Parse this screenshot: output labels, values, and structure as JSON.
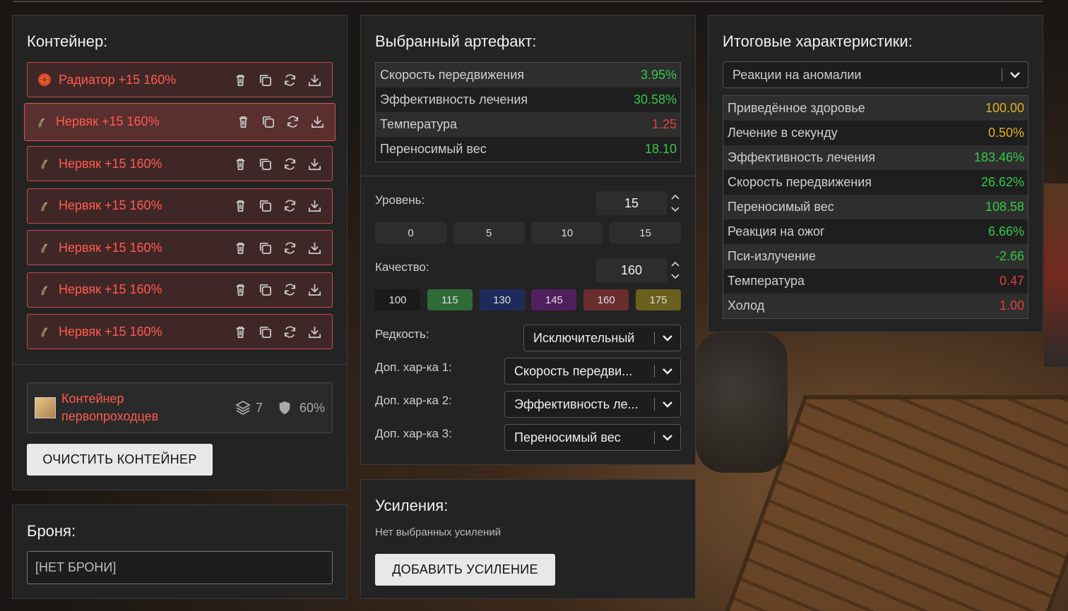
{
  "container": {
    "title": "Контейнер:",
    "artifacts": [
      {
        "name": "Радиатор +15 160%",
        "icon": "radiator-artifact-icon"
      },
      {
        "name": "Нервяк +15 160%",
        "icon": "nerviak-artifact-icon"
      },
      {
        "name": "Нервяк +15 160%",
        "icon": "nerviak-artifact-icon"
      },
      {
        "name": "Нервяк +15 160%",
        "icon": "nerviak-artifact-icon"
      },
      {
        "name": "Нервяк +15 160%",
        "icon": "nerviak-artifact-icon"
      },
      {
        "name": "Нервяк +15 160%",
        "icon": "nerviak-artifact-icon"
      },
      {
        "name": "Нервяк +15 160%",
        "icon": "nerviak-artifact-icon"
      }
    ],
    "selected_index": 1,
    "card": {
      "name_line1": "Контейнер",
      "name_line2": "первопроходцев",
      "slots": "7",
      "protection": "60%"
    },
    "clear_label": "ОЧИСТИТЬ КОНТЕЙНЕР"
  },
  "armor": {
    "title": "Броня:",
    "value": "[НЕТ БРОНИ]"
  },
  "artifact": {
    "title": "Выбранный артефакт:",
    "stats": [
      {
        "label": "Скорость передвижения",
        "value": "3.95%",
        "color": "green"
      },
      {
        "label": "Эффективность лечения",
        "value": "30.58%",
        "color": "green"
      },
      {
        "label": "Температура",
        "value": "1.25",
        "color": "red"
      },
      {
        "label": "Переносимый вес",
        "value": "18.10",
        "color": "green"
      }
    ],
    "level_label": "Уровень:",
    "level_value": "15",
    "level_presets": [
      "0",
      "5",
      "10",
      "15"
    ],
    "quality_label": "Качество:",
    "quality_value": "160",
    "quality_presets": [
      {
        "label": "100",
        "color": "#1a1a1a"
      },
      {
        "label": "115",
        "color": "#2e6b36"
      },
      {
        "label": "130",
        "color": "#1f2a5c"
      },
      {
        "label": "145",
        "color": "#4f1f5e"
      },
      {
        "label": "160",
        "color": "#6b2e2e"
      },
      {
        "label": "175",
        "color": "#6b5f1e"
      }
    ],
    "rarity_label": "Редкость:",
    "rarity_value": "Исключительный",
    "extra1_label": "Доп. хар-ка 1:",
    "extra1_value": "Скорость передви...",
    "extra2_label": "Доп. хар-ка 2:",
    "extra2_value": "Эффективность ле...",
    "extra3_label": "Доп. хар-ка 3:",
    "extra3_value": "Переносимый вес"
  },
  "boosts": {
    "title": "Усиления:",
    "empty": "Нет выбранных усилений",
    "add_label": "ДОБАВИТЬ УСИЛЕНИЕ"
  },
  "totals": {
    "title": "Итоговые характеристики:",
    "filter_value": "Реакции на аномалии",
    "stats": [
      {
        "label": "Приведённое здоровье",
        "value": "100.00",
        "color": "yellow"
      },
      {
        "label": "Лечение в секунду",
        "value": "0.50%",
        "color": "yellow"
      },
      {
        "label": "Эффективность лечения",
        "value": "183.46%",
        "color": "green"
      },
      {
        "label": "Скорость передвижения",
        "value": "26.62%",
        "color": "green"
      },
      {
        "label": "Переносимый вес",
        "value": "108.58",
        "color": "green"
      },
      {
        "label": "Реакция на ожог",
        "value": "6.66%",
        "color": "green"
      },
      {
        "label": "Пси-излучение",
        "value": "-2.66",
        "color": "green"
      },
      {
        "label": "Температура",
        "value": "0.47",
        "color": "red"
      },
      {
        "label": "Холод",
        "value": "1.00",
        "color": "red"
      }
    ]
  }
}
